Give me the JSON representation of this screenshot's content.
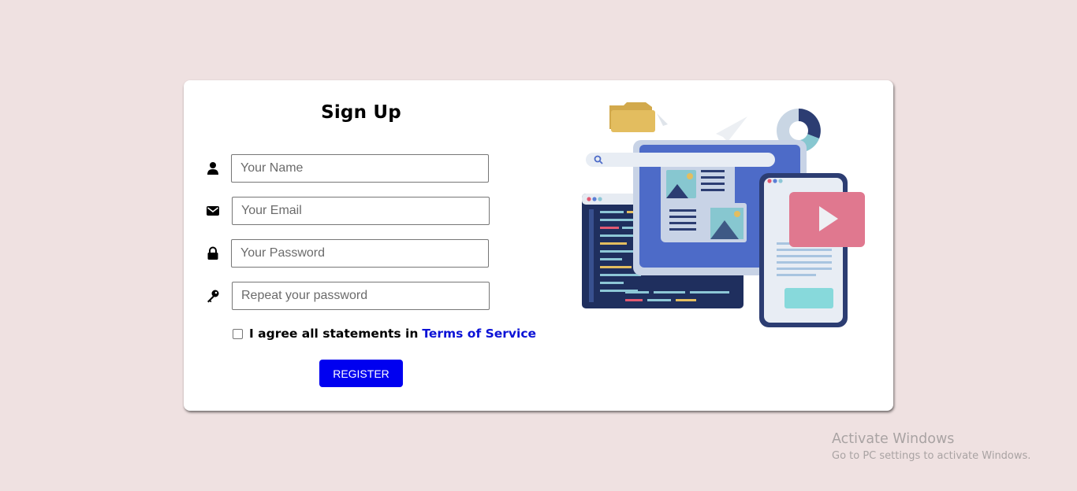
{
  "form": {
    "title": "Sign Up",
    "fields": [
      {
        "name": "name",
        "icon": "user-icon",
        "placeholder": "Your Name",
        "value": ""
      },
      {
        "name": "email",
        "icon": "envelope-icon",
        "placeholder": "Your Email",
        "value": ""
      },
      {
        "name": "password",
        "icon": "lock-icon",
        "placeholder": "Your Password",
        "value": ""
      },
      {
        "name": "repeat-password",
        "icon": "key-icon",
        "placeholder": "Repeat your password",
        "value": ""
      }
    ],
    "agree_text": "I agree all statements in",
    "terms_link": "Terms of Service",
    "register_label": "REGISTER"
  },
  "colors": {
    "page_background": "#efe1e1",
    "card_background": "#ffffff",
    "register_button": "#0000f0",
    "link": "#0b12d6"
  },
  "watermark": {
    "line1": "Activate Windows",
    "line2": "Go to PC settings to activate Windows."
  }
}
